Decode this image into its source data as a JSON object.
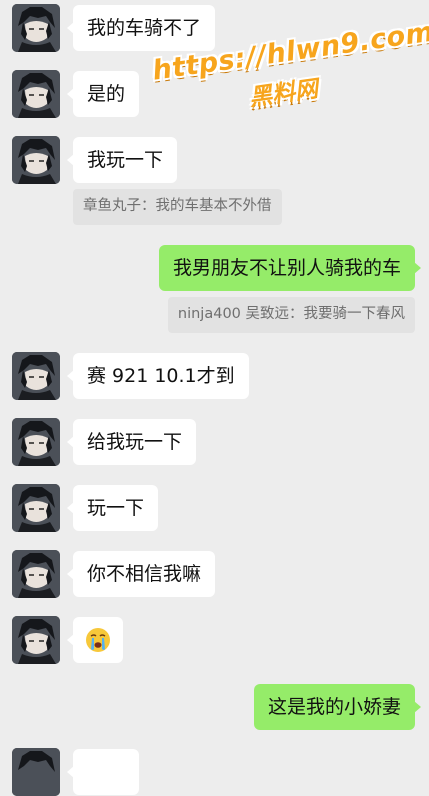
{
  "watermark": {
    "line1": "https://hlwn9.com",
    "line2": "黑料网"
  },
  "messages": [
    {
      "text": "我的车骑不了"
    },
    {
      "text": "是的"
    },
    {
      "text": "我玩一下"
    },
    {
      "quote": "章鱼丸子：我的车基本不外借"
    },
    {
      "text": "我男朋友不让别人骑我的车"
    },
    {
      "quote": "ninja400 吴致远：我要骑一下春风"
    },
    {
      "text": "赛 921 10.1才到"
    },
    {
      "text": "给我玩一下"
    },
    {
      "text": "玩一下"
    },
    {
      "text": "你不相信我嘛"
    },
    {
      "emoji": "crying-face-icon"
    },
    {
      "text": "这是我的小娇妻"
    }
  ],
  "colors": {
    "background": "#ededed",
    "bubble_left": "#ffffff",
    "bubble_right": "#95ec69",
    "quote": "#e2e2e2"
  }
}
